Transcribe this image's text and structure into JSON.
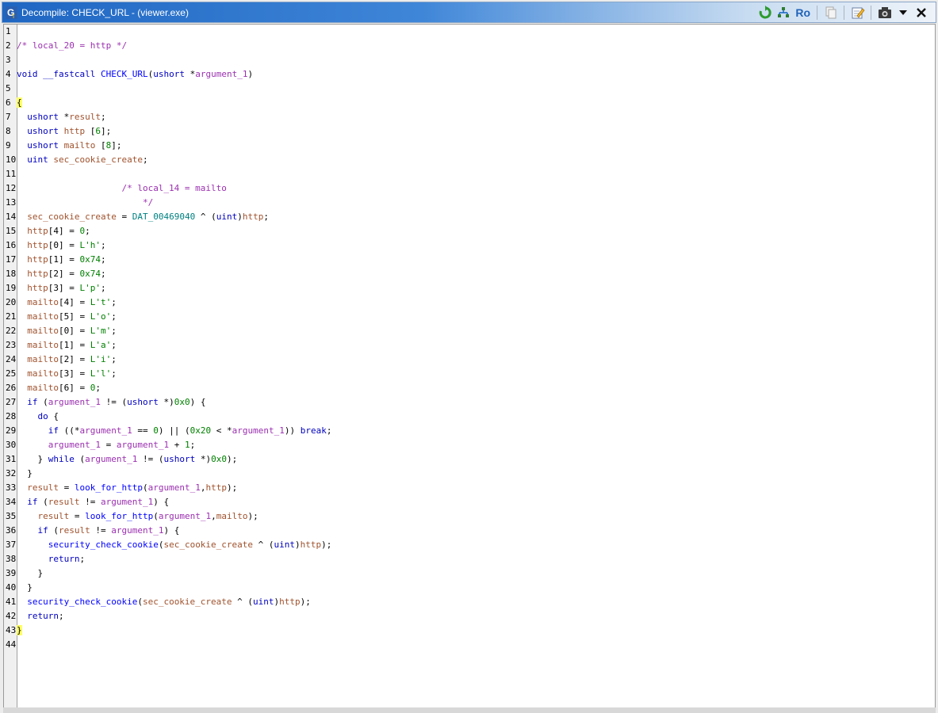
{
  "window": {
    "title": "Decompile: CHECK_URL -  (viewer.exe)",
    "toolbar": {
      "refresh_icon": "refresh-icon",
      "graph_icon": "function-graph-icon",
      "ro_label": "Ro",
      "copy_icon": "copy-icon",
      "edit_icon": "edit-icon",
      "snapshot_icon": "snapshot-icon",
      "menu_icon": "chevron-down-icon",
      "close_icon": "close-icon"
    }
  },
  "colors": {
    "keyword": "#0000c0",
    "function": "#0000ff",
    "variable": "#a0522d",
    "parameter": "#9b30b0",
    "comment": "#9b30b0",
    "number": "#008000",
    "global": "#008080",
    "brace_highlight": "#ffff66"
  },
  "code": {
    "lines": [
      {
        "num": "1",
        "tokens": []
      },
      {
        "num": "2",
        "tokens": [
          {
            "c": "cm",
            "t": "/* local_20 = http */"
          }
        ]
      },
      {
        "num": "3",
        "tokens": []
      },
      {
        "num": "4",
        "tokens": [
          {
            "c": "ty",
            "t": "void"
          },
          {
            "c": "pn",
            "t": " "
          },
          {
            "c": "kw",
            "t": "__fastcall"
          },
          {
            "c": "pn",
            "t": " "
          },
          {
            "c": "fn",
            "t": "CHECK_URL"
          },
          {
            "c": "pn",
            "t": "("
          },
          {
            "c": "ty",
            "t": "ushort"
          },
          {
            "c": "pn",
            "t": " *"
          },
          {
            "c": "pm",
            "t": "argument_1"
          },
          {
            "c": "pn",
            "t": ")"
          }
        ]
      },
      {
        "num": "5",
        "tokens": []
      },
      {
        "num": "6",
        "tokens": [
          {
            "c": "brace",
            "t": "{"
          }
        ]
      },
      {
        "num": "7",
        "tokens": [
          {
            "c": "pn",
            "t": "  "
          },
          {
            "c": "ty",
            "t": "ushort"
          },
          {
            "c": "pn",
            "t": " *"
          },
          {
            "c": "vr",
            "t": "result"
          },
          {
            "c": "pn",
            "t": ";"
          }
        ]
      },
      {
        "num": "8",
        "tokens": [
          {
            "c": "pn",
            "t": "  "
          },
          {
            "c": "ty",
            "t": "ushort"
          },
          {
            "c": "pn",
            "t": " "
          },
          {
            "c": "vr",
            "t": "http"
          },
          {
            "c": "pn",
            "t": " ["
          },
          {
            "c": "nm",
            "t": "6"
          },
          {
            "c": "pn",
            "t": "];"
          }
        ]
      },
      {
        "num": "9",
        "tokens": [
          {
            "c": "pn",
            "t": "  "
          },
          {
            "c": "ty",
            "t": "ushort"
          },
          {
            "c": "pn",
            "t": " "
          },
          {
            "c": "vr",
            "t": "mailto"
          },
          {
            "c": "pn",
            "t": " ["
          },
          {
            "c": "nm",
            "t": "8"
          },
          {
            "c": "pn",
            "t": "];"
          }
        ]
      },
      {
        "num": "10",
        "tokens": [
          {
            "c": "pn",
            "t": "  "
          },
          {
            "c": "ty",
            "t": "uint"
          },
          {
            "c": "pn",
            "t": " "
          },
          {
            "c": "vr",
            "t": "sec_cookie_create"
          },
          {
            "c": "pn",
            "t": ";"
          }
        ]
      },
      {
        "num": "11",
        "tokens": []
      },
      {
        "num": "12",
        "tokens": [
          {
            "c": "pn",
            "t": "                    "
          },
          {
            "c": "cm",
            "t": "/* local_14 = mailto"
          }
        ]
      },
      {
        "num": "13",
        "tokens": [
          {
            "c": "pn",
            "t": "                        "
          },
          {
            "c": "cm",
            "t": "*/"
          }
        ]
      },
      {
        "num": "14",
        "tokens": [
          {
            "c": "pn",
            "t": "  "
          },
          {
            "c": "vr",
            "t": "sec_cookie_create"
          },
          {
            "c": "pn",
            "t": " = "
          },
          {
            "c": "gl",
            "t": "DAT_00469040"
          },
          {
            "c": "pn",
            "t": " ^ ("
          },
          {
            "c": "ty",
            "t": "uint"
          },
          {
            "c": "pn",
            "t": ")"
          },
          {
            "c": "vr",
            "t": "http"
          },
          {
            "c": "pn",
            "t": ";"
          }
        ]
      },
      {
        "num": "15",
        "tokens": [
          {
            "c": "pn",
            "t": "  "
          },
          {
            "c": "vr",
            "t": "http"
          },
          {
            "c": "pn",
            "t": "[4] = "
          },
          {
            "c": "nm",
            "t": "0"
          },
          {
            "c": "pn",
            "t": ";"
          }
        ]
      },
      {
        "num": "16",
        "tokens": [
          {
            "c": "pn",
            "t": "  "
          },
          {
            "c": "vr",
            "t": "http"
          },
          {
            "c": "pn",
            "t": "[0] = "
          },
          {
            "c": "nm",
            "t": "L'h'"
          },
          {
            "c": "pn",
            "t": ";"
          }
        ]
      },
      {
        "num": "17",
        "tokens": [
          {
            "c": "pn",
            "t": "  "
          },
          {
            "c": "vr",
            "t": "http"
          },
          {
            "c": "pn",
            "t": "[1] = "
          },
          {
            "c": "nm",
            "t": "0x74"
          },
          {
            "c": "pn",
            "t": ";"
          }
        ]
      },
      {
        "num": "18",
        "tokens": [
          {
            "c": "pn",
            "t": "  "
          },
          {
            "c": "vr",
            "t": "http"
          },
          {
            "c": "pn",
            "t": "[2] = "
          },
          {
            "c": "nm",
            "t": "0x74"
          },
          {
            "c": "pn",
            "t": ";"
          }
        ]
      },
      {
        "num": "19",
        "tokens": [
          {
            "c": "pn",
            "t": "  "
          },
          {
            "c": "vr",
            "t": "http"
          },
          {
            "c": "pn",
            "t": "[3] = "
          },
          {
            "c": "nm",
            "t": "L'p'"
          },
          {
            "c": "pn",
            "t": ";"
          }
        ]
      },
      {
        "num": "20",
        "tokens": [
          {
            "c": "pn",
            "t": "  "
          },
          {
            "c": "vr",
            "t": "mailto"
          },
          {
            "c": "pn",
            "t": "[4] = "
          },
          {
            "c": "nm",
            "t": "L't'"
          },
          {
            "c": "pn",
            "t": ";"
          }
        ]
      },
      {
        "num": "21",
        "tokens": [
          {
            "c": "pn",
            "t": "  "
          },
          {
            "c": "vr",
            "t": "mailto"
          },
          {
            "c": "pn",
            "t": "[5] = "
          },
          {
            "c": "nm",
            "t": "L'o'"
          },
          {
            "c": "pn",
            "t": ";"
          }
        ]
      },
      {
        "num": "22",
        "tokens": [
          {
            "c": "pn",
            "t": "  "
          },
          {
            "c": "vr",
            "t": "mailto"
          },
          {
            "c": "pn",
            "t": "[0] = "
          },
          {
            "c": "nm",
            "t": "L'm'"
          },
          {
            "c": "pn",
            "t": ";"
          }
        ]
      },
      {
        "num": "23",
        "tokens": [
          {
            "c": "pn",
            "t": "  "
          },
          {
            "c": "vr",
            "t": "mailto"
          },
          {
            "c": "pn",
            "t": "[1] = "
          },
          {
            "c": "nm",
            "t": "L'a'"
          },
          {
            "c": "pn",
            "t": ";"
          }
        ]
      },
      {
        "num": "24",
        "tokens": [
          {
            "c": "pn",
            "t": "  "
          },
          {
            "c": "vr",
            "t": "mailto"
          },
          {
            "c": "pn",
            "t": "[2] = "
          },
          {
            "c": "nm",
            "t": "L'i'"
          },
          {
            "c": "pn",
            "t": ";"
          }
        ]
      },
      {
        "num": "25",
        "tokens": [
          {
            "c": "pn",
            "t": "  "
          },
          {
            "c": "vr",
            "t": "mailto"
          },
          {
            "c": "pn",
            "t": "[3] = "
          },
          {
            "c": "nm",
            "t": "L'l'"
          },
          {
            "c": "pn",
            "t": ";"
          }
        ]
      },
      {
        "num": "26",
        "tokens": [
          {
            "c": "pn",
            "t": "  "
          },
          {
            "c": "vr",
            "t": "mailto"
          },
          {
            "c": "pn",
            "t": "[6] = "
          },
          {
            "c": "nm",
            "t": "0"
          },
          {
            "c": "pn",
            "t": ";"
          }
        ]
      },
      {
        "num": "27",
        "tokens": [
          {
            "c": "pn",
            "t": "  "
          },
          {
            "c": "kw",
            "t": "if"
          },
          {
            "c": "pn",
            "t": " ("
          },
          {
            "c": "pm",
            "t": "argument_1"
          },
          {
            "c": "pn",
            "t": " != ("
          },
          {
            "c": "ty",
            "t": "ushort"
          },
          {
            "c": "pn",
            "t": " *)"
          },
          {
            "c": "nm",
            "t": "0x0"
          },
          {
            "c": "pn",
            "t": ") {"
          }
        ]
      },
      {
        "num": "28",
        "tokens": [
          {
            "c": "pn",
            "t": "    "
          },
          {
            "c": "kw",
            "t": "do"
          },
          {
            "c": "pn",
            "t": " {"
          }
        ]
      },
      {
        "num": "29",
        "tokens": [
          {
            "c": "pn",
            "t": "      "
          },
          {
            "c": "kw",
            "t": "if"
          },
          {
            "c": "pn",
            "t": " ((*"
          },
          {
            "c": "pm",
            "t": "argument_1"
          },
          {
            "c": "pn",
            "t": " == "
          },
          {
            "c": "nm",
            "t": "0"
          },
          {
            "c": "pn",
            "t": ") || ("
          },
          {
            "c": "nm",
            "t": "0x20"
          },
          {
            "c": "pn",
            "t": " < *"
          },
          {
            "c": "pm",
            "t": "argument_1"
          },
          {
            "c": "pn",
            "t": ")) "
          },
          {
            "c": "kw",
            "t": "break"
          },
          {
            "c": "pn",
            "t": ";"
          }
        ]
      },
      {
        "num": "30",
        "tokens": [
          {
            "c": "pn",
            "t": "      "
          },
          {
            "c": "pm",
            "t": "argument_1"
          },
          {
            "c": "pn",
            "t": " = "
          },
          {
            "c": "pm",
            "t": "argument_1"
          },
          {
            "c": "pn",
            "t": " + "
          },
          {
            "c": "nm",
            "t": "1"
          },
          {
            "c": "pn",
            "t": ";"
          }
        ]
      },
      {
        "num": "31",
        "tokens": [
          {
            "c": "pn",
            "t": "    } "
          },
          {
            "c": "kw",
            "t": "while"
          },
          {
            "c": "pn",
            "t": " ("
          },
          {
            "c": "pm",
            "t": "argument_1"
          },
          {
            "c": "pn",
            "t": " != ("
          },
          {
            "c": "ty",
            "t": "ushort"
          },
          {
            "c": "pn",
            "t": " *)"
          },
          {
            "c": "nm",
            "t": "0x0"
          },
          {
            "c": "pn",
            "t": ");"
          }
        ]
      },
      {
        "num": "32",
        "tokens": [
          {
            "c": "pn",
            "t": "  }"
          }
        ]
      },
      {
        "num": "33",
        "tokens": [
          {
            "c": "pn",
            "t": "  "
          },
          {
            "c": "vr",
            "t": "result"
          },
          {
            "c": "pn",
            "t": " = "
          },
          {
            "c": "fn",
            "t": "look_for_http"
          },
          {
            "c": "pn",
            "t": "("
          },
          {
            "c": "pm",
            "t": "argument_1"
          },
          {
            "c": "pn",
            "t": ","
          },
          {
            "c": "vr",
            "t": "http"
          },
          {
            "c": "pn",
            "t": ");"
          }
        ]
      },
      {
        "num": "34",
        "tokens": [
          {
            "c": "pn",
            "t": "  "
          },
          {
            "c": "kw",
            "t": "if"
          },
          {
            "c": "pn",
            "t": " ("
          },
          {
            "c": "vr",
            "t": "result"
          },
          {
            "c": "pn",
            "t": " != "
          },
          {
            "c": "pm",
            "t": "argument_1"
          },
          {
            "c": "pn",
            "t": ") {"
          }
        ]
      },
      {
        "num": "35",
        "tokens": [
          {
            "c": "pn",
            "t": "    "
          },
          {
            "c": "vr",
            "t": "result"
          },
          {
            "c": "pn",
            "t": " = "
          },
          {
            "c": "fn",
            "t": "look_for_http"
          },
          {
            "c": "pn",
            "t": "("
          },
          {
            "c": "pm",
            "t": "argument_1"
          },
          {
            "c": "pn",
            "t": ","
          },
          {
            "c": "vr",
            "t": "mailto"
          },
          {
            "c": "pn",
            "t": ");"
          }
        ]
      },
      {
        "num": "36",
        "tokens": [
          {
            "c": "pn",
            "t": "    "
          },
          {
            "c": "kw",
            "t": "if"
          },
          {
            "c": "pn",
            "t": " ("
          },
          {
            "c": "vr",
            "t": "result"
          },
          {
            "c": "pn",
            "t": " != "
          },
          {
            "c": "pm",
            "t": "argument_1"
          },
          {
            "c": "pn",
            "t": ") {"
          }
        ]
      },
      {
        "num": "37",
        "tokens": [
          {
            "c": "pn",
            "t": "      "
          },
          {
            "c": "fn",
            "t": "security_check_cookie"
          },
          {
            "c": "pn",
            "t": "("
          },
          {
            "c": "vr",
            "t": "sec_cookie_create"
          },
          {
            "c": "pn",
            "t": " ^ ("
          },
          {
            "c": "ty",
            "t": "uint"
          },
          {
            "c": "pn",
            "t": ")"
          },
          {
            "c": "vr",
            "t": "http"
          },
          {
            "c": "pn",
            "t": ");"
          }
        ]
      },
      {
        "num": "38",
        "tokens": [
          {
            "c": "pn",
            "t": "      "
          },
          {
            "c": "kw",
            "t": "return"
          },
          {
            "c": "pn",
            "t": ";"
          }
        ]
      },
      {
        "num": "39",
        "tokens": [
          {
            "c": "pn",
            "t": "    }"
          }
        ]
      },
      {
        "num": "40",
        "tokens": [
          {
            "c": "pn",
            "t": "  }"
          }
        ]
      },
      {
        "num": "41",
        "tokens": [
          {
            "c": "pn",
            "t": "  "
          },
          {
            "c": "fn",
            "t": "security_check_cookie"
          },
          {
            "c": "pn",
            "t": "("
          },
          {
            "c": "vr",
            "t": "sec_cookie_create"
          },
          {
            "c": "pn",
            "t": " ^ ("
          },
          {
            "c": "ty",
            "t": "uint"
          },
          {
            "c": "pn",
            "t": ")"
          },
          {
            "c": "vr",
            "t": "http"
          },
          {
            "c": "pn",
            "t": ");"
          }
        ]
      },
      {
        "num": "42",
        "tokens": [
          {
            "c": "pn",
            "t": "  "
          },
          {
            "c": "kw",
            "t": "return"
          },
          {
            "c": "pn",
            "t": ";"
          }
        ]
      },
      {
        "num": "43",
        "tokens": [
          {
            "c": "brace",
            "t": "}"
          }
        ]
      },
      {
        "num": "44",
        "tokens": []
      }
    ]
  }
}
